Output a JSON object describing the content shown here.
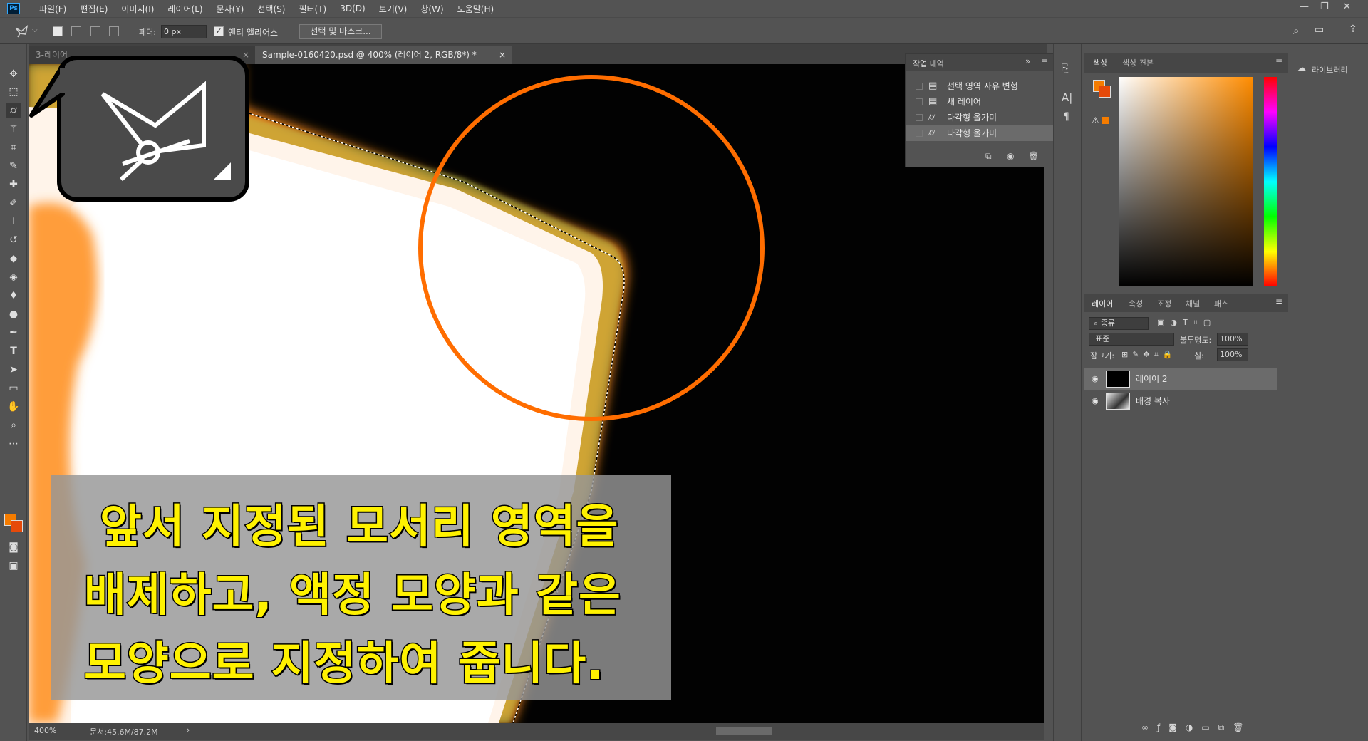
{
  "menu": {
    "logo": "Ps",
    "items": [
      "파일(F)",
      "편집(E)",
      "이미지(I)",
      "레이어(L)",
      "문자(Y)",
      "선택(S)",
      "필터(T)",
      "3D(D)",
      "보기(V)",
      "창(W)",
      "도움말(H)"
    ]
  },
  "options": {
    "feather_label": "페더:",
    "feather_value": "0 px",
    "antialias_label": "앤티 앨리어스",
    "select_mask_label": "선택 및 마스크..."
  },
  "tabs": [
    {
      "label": "3-레이어 ..."
    },
    {
      "label": "Sample-0160420.psd @ 400% (레이어 2, RGB/8*) *"
    }
  ],
  "caption": {
    "line1": "앞서 지정된 모서리 영역을",
    "line2": "배제하고, 액정 모양과 같은",
    "line3": "모양으로  지정하여 줍니다."
  },
  "history": {
    "title": "작업 내역",
    "items": [
      "선택 영역 자유 변형",
      "새 레이어",
      "다각형 올가미",
      "다각형 올가미"
    ]
  },
  "color_panel": {
    "tabs": [
      "색상",
      "색상 견본"
    ],
    "foreground": "#f57c00",
    "background": "#e64a0a"
  },
  "layers": {
    "tabs": [
      "레이어",
      "속성",
      "조정",
      "채널",
      "패스"
    ],
    "filter_label": "종류",
    "blend_mode": "표준",
    "opacity_label": "불투명도:",
    "opacity_value": "100%",
    "lock_label": "잠그기:",
    "fill_label": "칠:",
    "fill_value": "100%",
    "items": [
      "레이어 2",
      "배경 복사"
    ]
  },
  "libraries": {
    "label": "라이브러리"
  },
  "status": {
    "zoom": "400%",
    "doc": "문서:45.6M/87.2M"
  },
  "colors": {
    "accent_orange": "#ff6d00",
    "caption_yellow": "#fff200"
  }
}
